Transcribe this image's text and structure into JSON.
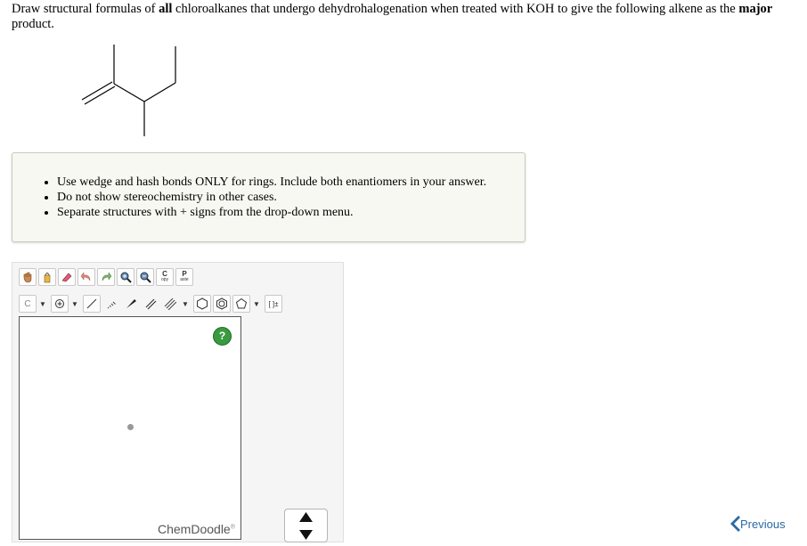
{
  "question": {
    "part1": "Draw structural formulas of ",
    "bold1": "all",
    "part2": " chloroalkanes that undergo dehydrohalogenation when treated with KOH to give the following alkene as the ",
    "bold2": "major",
    "part3": " product."
  },
  "instructions": [
    "Use wedge and hash bonds ONLY for rings. Include both enantiomers in your answer.",
    "Do not show stereochemistry in other cases.",
    "Separate structures with + signs from the drop-down menu."
  ],
  "toolbar": {
    "copy_label_top": "C",
    "copy_label_bottom": "opy",
    "paste_label_top": "P",
    "paste_label_bottom": "aste",
    "carbon_label": "C",
    "bracket_label": "[ ]±"
  },
  "editor": {
    "help_label": "?",
    "brand": "ChemDoodle",
    "brand_mark": "®"
  },
  "navigation": {
    "previous_label": "Previous"
  }
}
